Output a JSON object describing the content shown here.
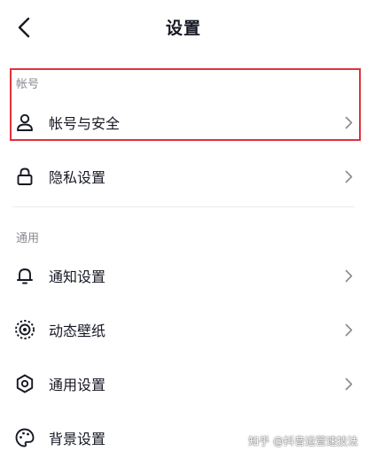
{
  "header": {
    "title": "设置"
  },
  "sections": [
    {
      "label": "帐号",
      "items": [
        {
          "label": "帐号与安全",
          "icon": "user-icon"
        },
        {
          "label": "隐私设置",
          "icon": "lock-icon"
        }
      ]
    },
    {
      "label": "通用",
      "items": [
        {
          "label": "通知设置",
          "icon": "bell-icon"
        },
        {
          "label": "动态壁纸",
          "icon": "live-wallpaper-icon"
        },
        {
          "label": "通用设置",
          "icon": "gear-icon"
        },
        {
          "label": "背景设置",
          "icon": "palette-icon"
        }
      ]
    }
  ],
  "watermark": "知乎 @抖音运营速技法",
  "colors": {
    "highlight": "#e0313b",
    "text": "#161823",
    "muted": "#8a8b91"
  }
}
